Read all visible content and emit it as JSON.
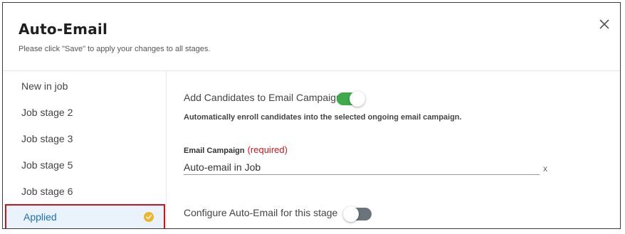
{
  "header": {
    "title": "Auto-Email",
    "subtitle": "Please click \"Save\" to apply your changes to all stages."
  },
  "sidebar": {
    "items": [
      {
        "label": "New in job"
      },
      {
        "label": "Job stage 2"
      },
      {
        "label": "Job stage 3"
      },
      {
        "label": "Job stage 5"
      },
      {
        "label": "Job stage 6"
      },
      {
        "label": "Applied",
        "selected": true,
        "configured": true
      }
    ]
  },
  "content": {
    "campaign_toggle": {
      "label": "Add Candidates to Email Campaign",
      "on": true
    },
    "campaign_description": "Automatically enroll candidates into the selected ongoing email campaign.",
    "email_campaign": {
      "label": "Email Campaign",
      "required_text": "(required)",
      "value": "Auto-email in Job",
      "clear_label": "x"
    },
    "configure_toggle": {
      "label": "Configure Auto-Email for this stage",
      "on": false
    }
  },
  "colors": {
    "toggle_on": "#3faa4a",
    "toggle_off": "#6b747c",
    "selected_bg": "#eaf3fb",
    "selected_text": "#1f6fb8",
    "highlight_border": "#c8141a",
    "required": "#d0191b",
    "check_badge": "#f0b429"
  },
  "icons": {
    "close": "close-icon",
    "selected_check": "check-circle-icon"
  }
}
